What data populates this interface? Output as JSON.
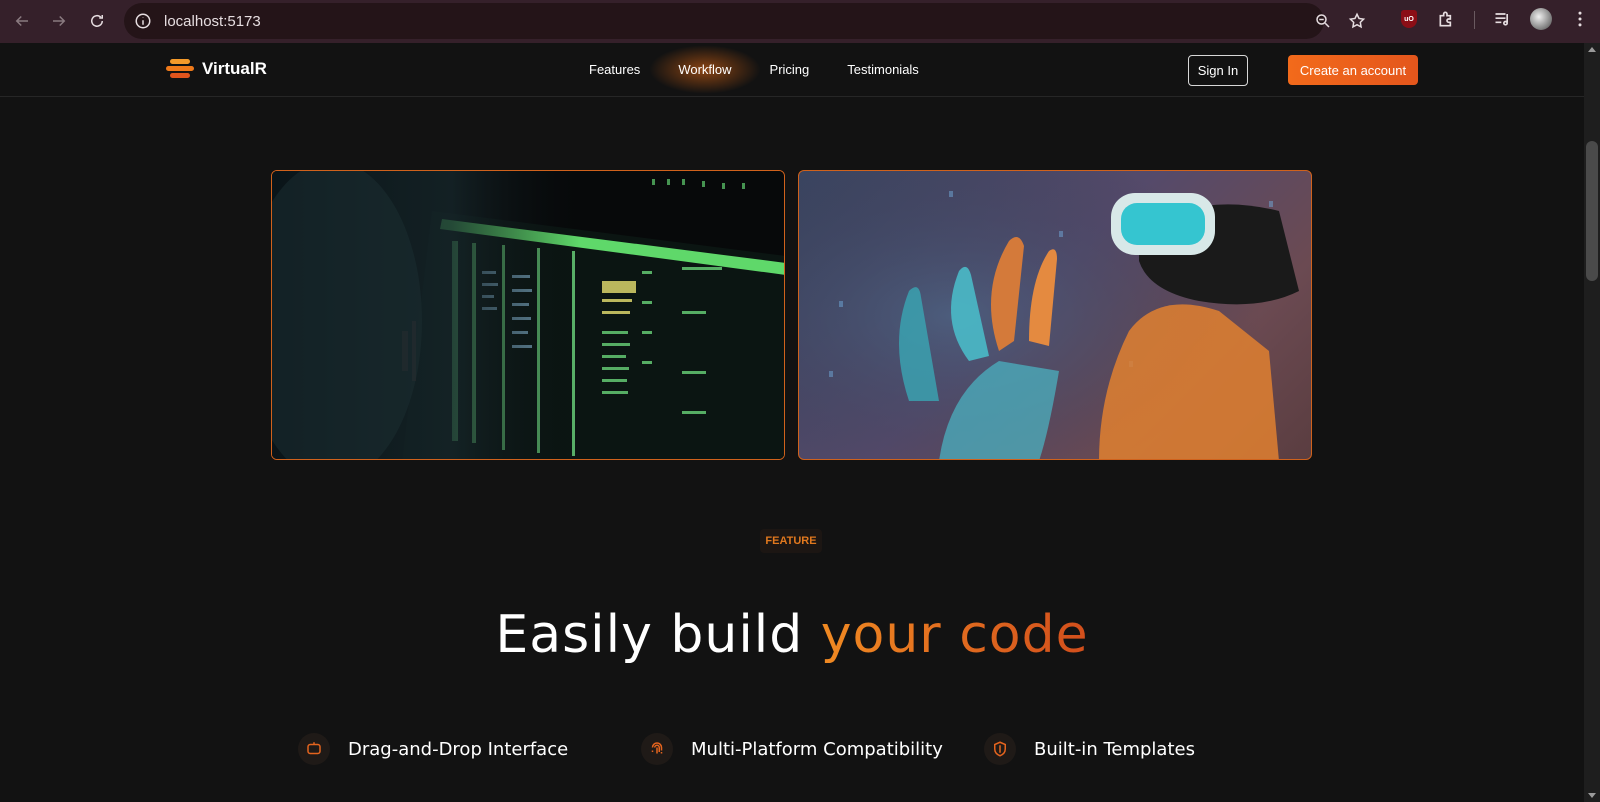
{
  "browser": {
    "url": "localhost:5173",
    "icons": [
      "back-arrow-icon",
      "forward-arrow-icon",
      "reload-icon",
      "site-info-icon",
      "zoom-icon",
      "bookmark-star-icon",
      "ublock-icon",
      "extensions-icon",
      "media-control-icon",
      "profile-avatar",
      "menu-kebab-icon"
    ],
    "ublock_label": "uO"
  },
  "header": {
    "brand": "VirtualR",
    "nav": [
      {
        "label": "Features"
      },
      {
        "label": "Workflow"
      },
      {
        "label": "Pricing"
      },
      {
        "label": "Testimonials"
      }
    ],
    "active_nav": "Workflow",
    "sign_in": "Sign In",
    "create_account": "Create an account"
  },
  "hero": {
    "images": [
      "coding-screen-photo",
      "vr-headset-photo"
    ]
  },
  "features": {
    "tag": "FEATURE",
    "headline_main": "Easily build ",
    "headline_accent": "your code",
    "items": [
      {
        "title": "Drag-and-Drop Interface",
        "icon": "chat-bot-icon"
      },
      {
        "title": "Multi-Platform Compatibility",
        "icon": "fingerprint-icon"
      },
      {
        "title": "Built-in Templates",
        "icon": "shield-icon"
      }
    ]
  },
  "colors": {
    "accent": "#ea6a1e",
    "background": "#121212",
    "browser_chrome": "#35202a"
  }
}
